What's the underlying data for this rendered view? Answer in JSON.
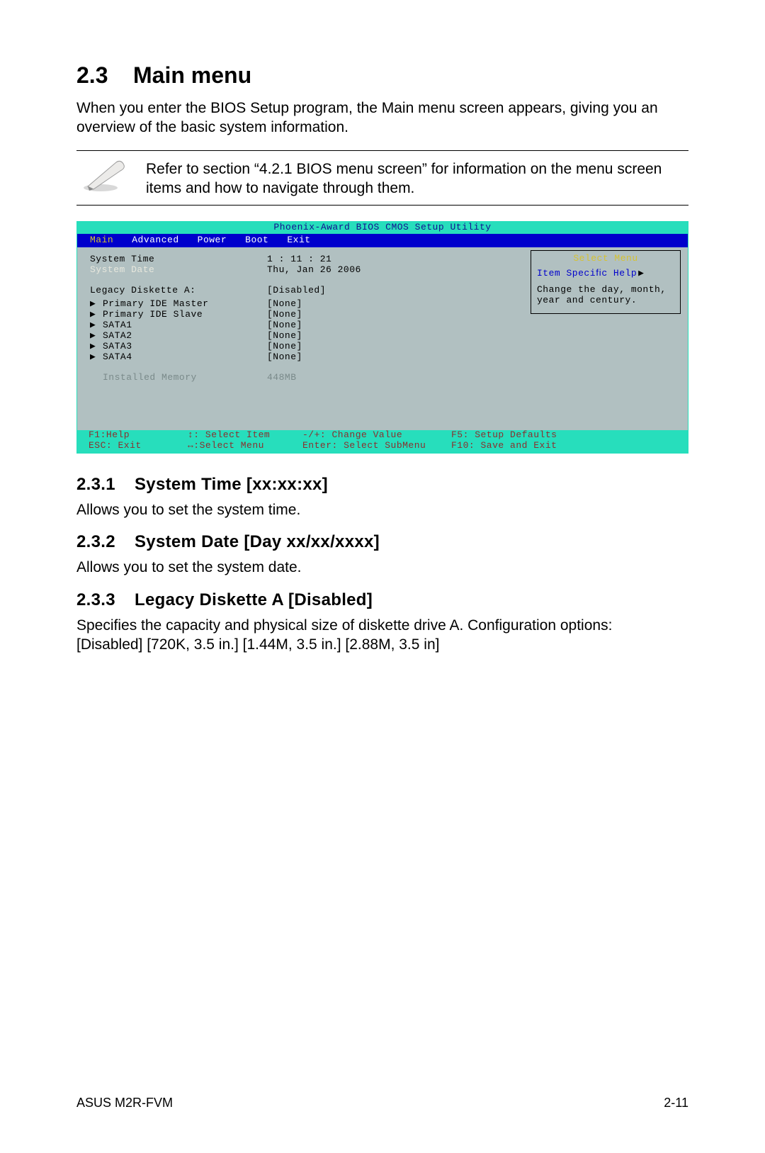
{
  "section": {
    "number": "2.3",
    "title": "Main menu",
    "intro": "When you enter the BIOS Setup program, the Main menu screen appears, giving you an overview of the basic system information.",
    "note": "Refer to section “4.2.1 BIOS menu screen” for information on the menu screen items and how to navigate through them."
  },
  "bios": {
    "title": "Phoenix-Award BIOS CMOS Setup Utility",
    "menu": [
      "Main",
      "Advanced",
      "Power",
      "Boot",
      "Exit"
    ],
    "active_menu": 0,
    "left": {
      "system_time_label": "System Time",
      "system_time_value": "1 : 11 : 21",
      "system_date_label": "System Date",
      "system_date_value": "Thu, Jan 26 2006",
      "legacy_label": "Legacy Diskette A:",
      "legacy_value": "[Disabled]",
      "devices": [
        {
          "label": "Primary IDE Master",
          "value": "[None]"
        },
        {
          "label": "Primary IDE Slave",
          "value": "[None]"
        },
        {
          "label": "SATA1",
          "value": "[None]"
        },
        {
          "label": "SATA2",
          "value": "[None]"
        },
        {
          "label": "SATA3",
          "value": "[None]"
        },
        {
          "label": "SATA4",
          "value": "[None]"
        }
      ],
      "installed_memory_label": "Installed Memory",
      "installed_memory_value": "448MB"
    },
    "right": {
      "title": "Select Menu",
      "sub": "Item Speciﬁc Help",
      "help": "Change the day, month, year and century."
    },
    "footer": {
      "r1c1": "F1:Help",
      "r1c2": "↕: Select Item",
      "r1c3": "-/+: Change Value",
      "r1c4": "F5: Setup Defaults",
      "r2c1": "ESC: Exit",
      "r2c2": "↔:Select Menu",
      "r2c3": "Enter: Select SubMenu",
      "r2c4": "F10: Save and Exit"
    }
  },
  "subs": {
    "s1_num": "2.3.1",
    "s1_title": "System Time [xx:xx:xx]",
    "s1_body": "Allows you to set the system time.",
    "s2_num": "2.3.2",
    "s2_title": "System Date [Day xx/xx/xxxx]",
    "s2_body": "Allows you to set the system date.",
    "s3_num": "2.3.3",
    "s3_title": "Legacy Diskette A [Disabled]",
    "s3_body": "Speciﬁes the capacity and physical size of diskette drive A. Conﬁguration options: [Disabled] [720K, 3.5 in.] [1.44M, 3.5 in.] [2.88M, 3.5 in]"
  },
  "footer": {
    "left": "ASUS M2R-FVM",
    "right": "2-11"
  }
}
